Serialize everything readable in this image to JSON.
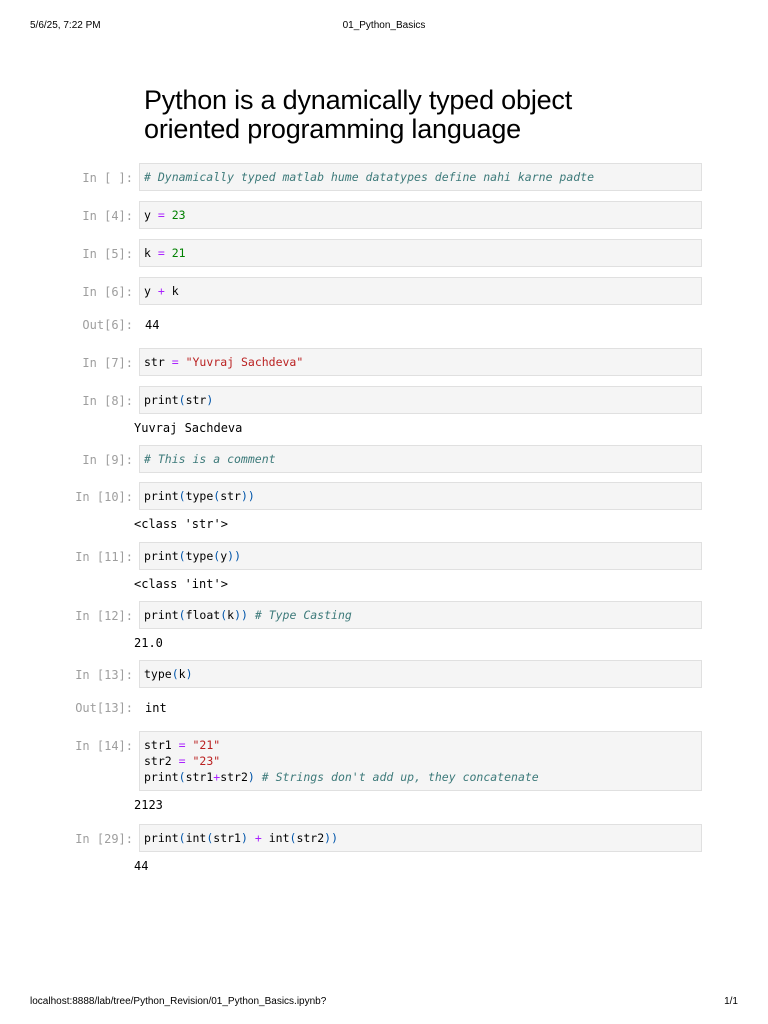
{
  "print_header": {
    "datetime": "5/6/25, 7:22 PM",
    "doc_title": "01_Python_Basics"
  },
  "print_footer": {
    "url": "localhost:8888/lab/tree/Python_Revision/01_Python_Basics.ipynb?",
    "page": "1/1"
  },
  "heading": {
    "line1": "Python is a dynamically typed object",
    "line2": "oriented programming language"
  },
  "cells": {
    "c1": {
      "prompt": "In [ ]:",
      "comment": "# Dynamically typed matlab hume datatypes define nahi karne padte"
    },
    "c2": {
      "prompt": "In [4]:",
      "var": "y ",
      "op": "=",
      "num": "23"
    },
    "c3": {
      "prompt": "In [5]:",
      "var": "k ",
      "op": "=",
      "num": "21"
    },
    "c4": {
      "prompt": "In [6]:",
      "a": "y ",
      "op": "+",
      "b": " k",
      "out_prompt": "Out[6]:",
      "out": "44"
    },
    "c5": {
      "prompt": "In [7]:",
      "var": "str ",
      "op": "=",
      "str": "\"Yuvraj Sachdeva\""
    },
    "c6": {
      "prompt": "In [8]:",
      "fn": "print",
      "lp": "(",
      "arg": "str",
      "rp": ")",
      "stdout": "Yuvraj Sachdeva"
    },
    "c7": {
      "prompt": "In [9]:",
      "comment": "# This is a comment"
    },
    "c8": {
      "prompt": "In [10]:",
      "fn": "print",
      "lp": "(",
      "fn2": "type",
      "lp2": "(",
      "arg": "str",
      "rp": "))",
      "stdout": "<class 'str'>"
    },
    "c9": {
      "prompt": "In [11]:",
      "fn": "print",
      "lp": "(",
      "fn2": "type",
      "lp2": "(",
      "arg": "y",
      "rp": "))",
      "stdout": "<class 'int'>"
    },
    "c10": {
      "prompt": "In [12]:",
      "fn": "print",
      "lp": "(",
      "fn2": "float",
      "lp2": "(",
      "arg": "k",
      "rp": "))",
      "comment": "# Type Casting",
      "stdout": "21.0"
    },
    "c11": {
      "prompt": "In [13]:",
      "fn": "type",
      "lp": "(",
      "arg": "k",
      "rp": ")",
      "out_prompt": "Out[13]:",
      "out": "int"
    },
    "c12": {
      "prompt": "In [14]:",
      "l1_var": "str1 ",
      "l1_op": "=",
      "l1_str": "\"21\"",
      "l2_var": "str2 ",
      "l2_op": "=",
      "l2_str": "\"23\"",
      "l3_fn": "print",
      "l3_lp": "(",
      "l3_a": "str1",
      "l3_op": "+",
      "l3_b": "str2",
      "l3_rp": ")",
      "l3_comment": "# Strings don't add up, they concatenate",
      "stdout": "2123"
    },
    "c13": {
      "prompt": "In [29]:",
      "fn": "print",
      "lp": "(",
      "fn2": "int",
      "lp2": "(",
      "a": "str1",
      "rp2": ")",
      "op": "+",
      "fn3": "int",
      "lp3": "(",
      "b": "str2",
      "rp": "))",
      "stdout": "44"
    }
  }
}
